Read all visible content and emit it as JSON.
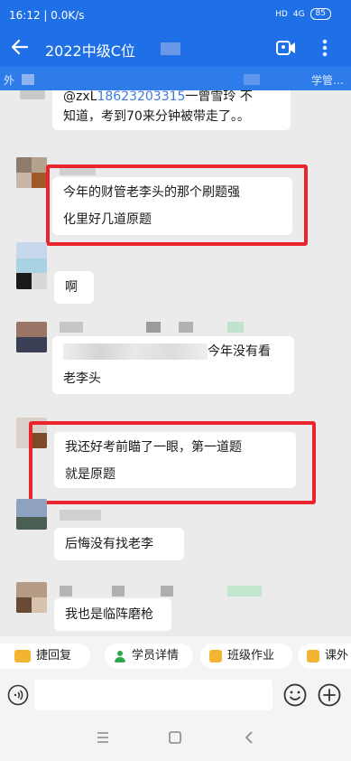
{
  "status": {
    "time": "16:12",
    "speed": "0.0K/s",
    "hd": "HD",
    "signal": "4G",
    "battery": "85"
  },
  "header": {
    "title": "2022中级C位",
    "sub_left": "外",
    "sub_right": "学管…"
  },
  "chat": {
    "quoted_text_prefix": "@zxL",
    "quoted_phone": "18623203315",
    "quoted_line1_suffix": "一曾雪玲 不",
    "quoted_line2": "知道，考到70来分钟被带走了。。",
    "m1_line1": "今年的财管老李头的那个刷题强",
    "m1_line2": "化里好几道原题",
    "m2": "啊",
    "m3_line1": "今年没有看",
    "m3_line2": "老李头",
    "m4_line1": "我还好考前瞄了一眼，第一道题",
    "m4_line2": "就是原题",
    "m5": "后悔没有找老李",
    "m6": "我也是临阵磨枪"
  },
  "quick_actions": [
    "捷回复",
    "学员详情",
    "班级作业",
    "课外"
  ],
  "colors": {
    "header": "#1f6fe6",
    "highlight": "#e8242d",
    "background": "#ebebeb"
  }
}
